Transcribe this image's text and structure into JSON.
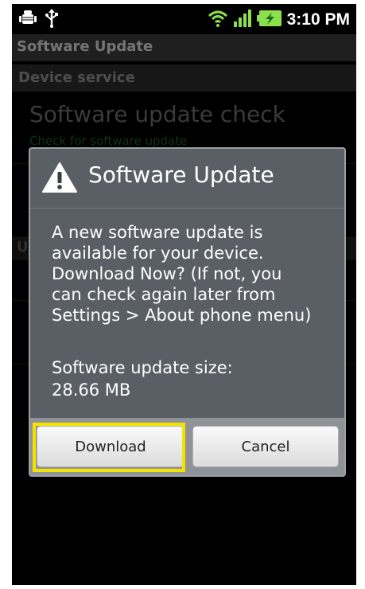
{
  "status_bar": {
    "time": "3:10 PM",
    "icons": [
      "android-debug-icon",
      "usb-icon",
      "wifi-icon",
      "signal-icon",
      "battery-charging-icon"
    ]
  },
  "app": {
    "title": "Software Update",
    "section_header": "Device service",
    "preference": {
      "title": "Software update check",
      "summary": "Check for software update"
    }
  },
  "dialog": {
    "icon": "warning-icon",
    "title": "Software Update",
    "message": "A new software update is\navailable for your device.\nDownload Now? (If not, you\ncan check again later from\nSettings > About phone menu)",
    "size_label": "Software update size:",
    "size_value": "28.66 MB",
    "buttons": {
      "download": "Download",
      "cancel": "Cancel"
    }
  },
  "colors": {
    "highlight": "#f5e400",
    "dialog_bg": "#5a5f66",
    "summary_green": "#1e5a2b"
  }
}
